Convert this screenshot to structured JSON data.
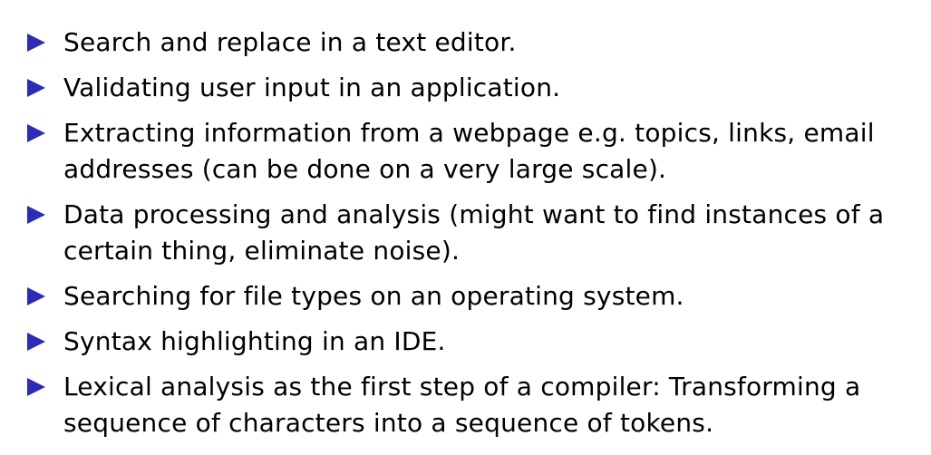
{
  "slide": {
    "bullet_color": "#2b2bb8",
    "bullets": [
      {
        "text": "Search and replace in a text editor."
      },
      {
        "text": "Validating user input in an application."
      },
      {
        "text": "Extracting information from a webpage e.g. topics, links, email addresses (can be done on a very large scale)."
      },
      {
        "text": "Data processing and analysis (might want to find instances of a certain thing, eliminate noise)."
      },
      {
        "text": "Searching for file types on an operating system."
      },
      {
        "text": "Syntax highlighting in an IDE."
      },
      {
        "text": "Lexical analysis as the first step of a compiler: Transforming a sequence of characters into a sequence of tokens."
      }
    ]
  }
}
